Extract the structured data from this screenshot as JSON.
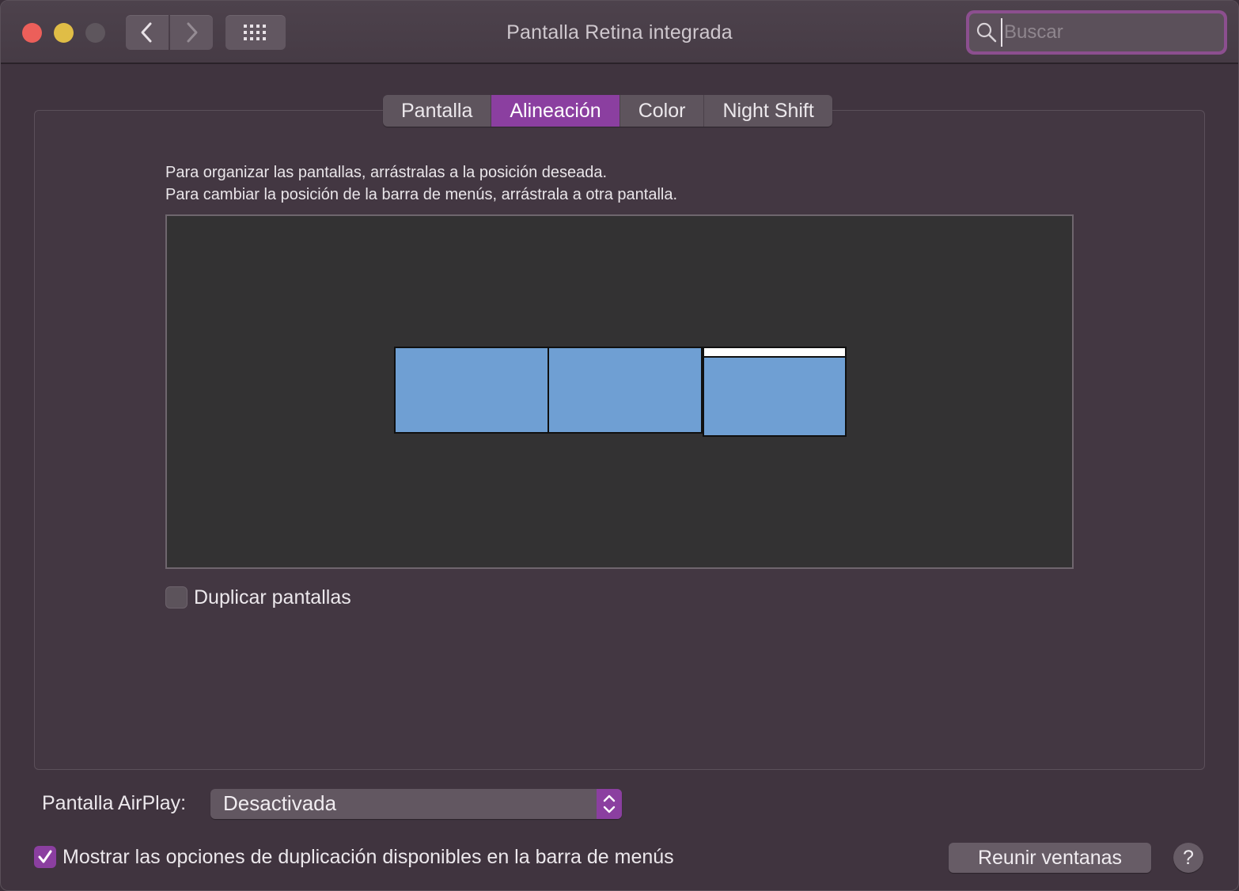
{
  "window": {
    "title": "Pantalla Retina integrada"
  },
  "toolbar": {
    "back_icon": "chevron-left-icon",
    "forward_icon": "chevron-right-icon",
    "show_all_icon": "grid-icon"
  },
  "search": {
    "placeholder": "Buscar",
    "value": ""
  },
  "tabs": [
    {
      "label": "Pantalla",
      "active": false
    },
    {
      "label": "Alineación",
      "active": true
    },
    {
      "label": "Color",
      "active": false
    },
    {
      "label": "Night Shift",
      "active": false
    }
  ],
  "arrangement": {
    "instruction_line1": "Para organizar las pantallas, arrástralas a la posición deseada.",
    "instruction_line2": "Para cambiar la posición de la barra de menús, arrástrala a otra pantalla.",
    "display_color": "#6f9fd3",
    "menubar_on_display": 3
  },
  "duplicate": {
    "label": "Duplicar pantallas",
    "checked": false
  },
  "airplay": {
    "label": "Pantalla AirPlay:",
    "value": "Desactivada"
  },
  "mirror_options": {
    "label": "Mostrar las opciones de duplicación disponibles en la barra de menús",
    "checked": true
  },
  "buttons": {
    "gather": "Reunir ventanas",
    "help": "?"
  },
  "colors": {
    "accent": "#8b3fa0"
  }
}
